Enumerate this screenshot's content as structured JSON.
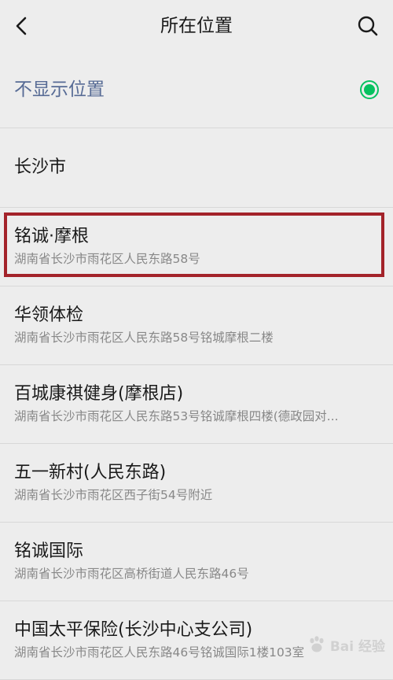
{
  "header": {
    "title": "所在位置",
    "back_icon": "chevron-left-icon",
    "search_icon": "search-icon"
  },
  "no_location": {
    "label": "不显示位置",
    "selected": true,
    "accent_color": "#07c160",
    "label_color": "#576b95"
  },
  "city": {
    "label": "长沙市"
  },
  "locations": [
    {
      "name": "铭诚·摩根",
      "address": "湖南省长沙市雨花区人民东路58号",
      "highlighted": true
    },
    {
      "name": "华领体检",
      "address": "湖南省长沙市雨花区人民东路58号铭城摩根二楼"
    },
    {
      "name": "百城康祺健身(摩根店)",
      "address": "湖南省长沙市雨花区人民东路53号铭诚摩根四楼(德政园对..."
    },
    {
      "name": "五一新村(人民东路)",
      "address": "湖南省长沙市雨花区西子街54号附近"
    },
    {
      "name": "铭诚国际",
      "address": "湖南省长沙市雨花区高桥街道人民东路46号"
    },
    {
      "name": "中国太平保险(长沙中心支公司)",
      "address": "湖南省长沙市雨花区人民东路46号铭诚国际1楼103室"
    }
  ],
  "highlight_color": "#a3232a",
  "watermark": {
    "text": "Bai 经验"
  }
}
